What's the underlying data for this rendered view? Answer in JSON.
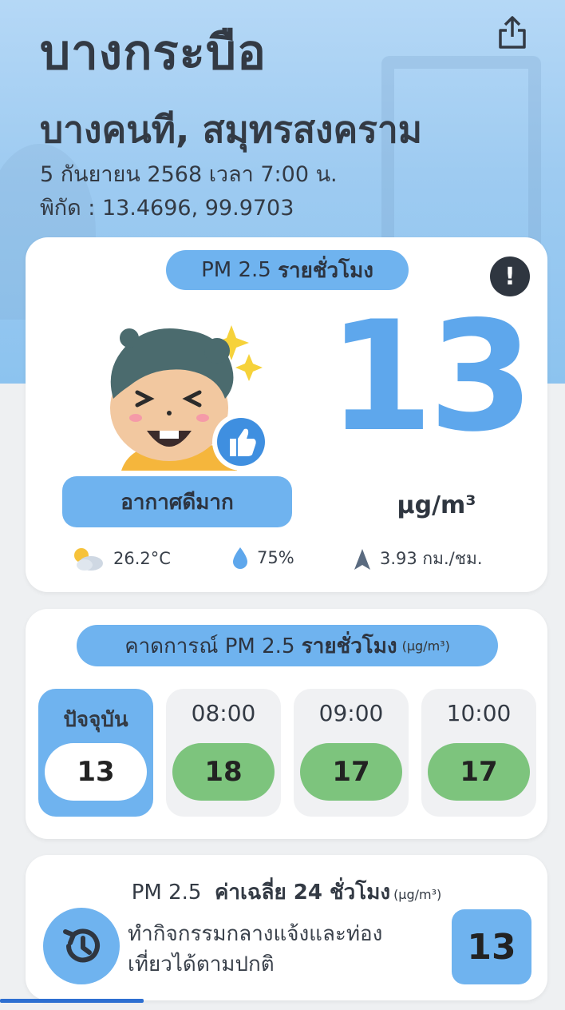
{
  "header": {
    "title": "บางกระบือ",
    "subtitle": "บางคนที, สมุทรสงคราม",
    "date": "5 กันยายน 2568  เวลา 7:00 น.",
    "coords": "พิกัด : 13.4696, 99.9703"
  },
  "main_card": {
    "pill_prefix": "PM 2.5 ",
    "pill_bold": "รายชั่วโมง",
    "status_label": "อากาศดีมาก",
    "value": "13",
    "unit": "µg/m³",
    "temperature": "26.2°C",
    "humidity": "75%",
    "wind": "3.93 กม./ชม."
  },
  "forecast": {
    "pill_prefix": "คาดการณ์ PM 2.5 ",
    "pill_bold": "รายชั่วโมง",
    "pill_unit": "(µg/m³)",
    "slots": [
      {
        "time": "ปัจจุบัน",
        "value": "13"
      },
      {
        "time": "08:00",
        "value": "18"
      },
      {
        "time": "09:00",
        "value": "17"
      },
      {
        "time": "10:00",
        "value": "17"
      }
    ]
  },
  "average": {
    "title_prefix": "PM 2.5 ",
    "title_bold": "ค่าเฉลี่ย 24 ชั่วโมง",
    "title_unit": "(µg/m³)",
    "advice_line1": "ทำกิจกรรมกลางแจ้งและท่อง",
    "advice_line2": "เที่ยวได้ตามปกติ",
    "value": "13"
  },
  "colors": {
    "accent_blue": "#6fb3ef",
    "value_blue": "#5ea7ec",
    "good_green": "#7dc47d"
  }
}
